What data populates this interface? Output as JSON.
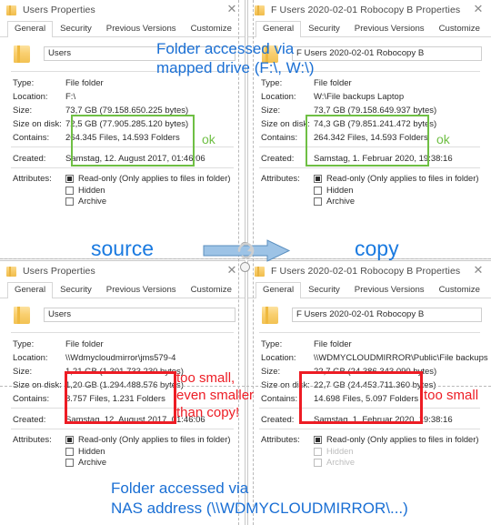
{
  "panels": {
    "top_left": {
      "window_title": "Users Properties",
      "close_label": "✕",
      "tabs": [
        "General",
        "Security",
        "Previous Versions",
        "Customize"
      ],
      "active_tab": "General",
      "name_value": "Users",
      "fields": [
        {
          "label": "Type:",
          "value": "File folder"
        },
        {
          "label": "Location:",
          "value": "F:\\"
        },
        {
          "label": "Size:",
          "value": "73,7 GB (79.158.650.225 bytes)"
        },
        {
          "label": "Size on disk:",
          "value": "72,5 GB (77.905.285.120 bytes)"
        },
        {
          "label": "Contains:",
          "value": "264.345 Files, 14.593 Folders"
        },
        {
          "label": "Created:",
          "value": "Samstag, 12. August 2017, 01:46:06"
        }
      ],
      "attributes_label": "Attributes:",
      "attributes": [
        {
          "text": "Read-only (Only applies to files in folder)",
          "state": "filled"
        },
        {
          "text": "Hidden",
          "state": "empty"
        },
        {
          "text": "Archive",
          "state": "empty"
        }
      ]
    },
    "top_right": {
      "window_title": "F Users 2020-02-01 Robocopy B Properties",
      "close_label": "✕",
      "tabs": [
        "General",
        "Security",
        "Previous Versions",
        "Customize"
      ],
      "active_tab": "General",
      "name_value": "F Users 2020-02-01 Robocopy B",
      "fields": [
        {
          "label": "Type:",
          "value": "File folder"
        },
        {
          "label": "Location:",
          "value": "W:\\File backups Laptop"
        },
        {
          "label": "Size:",
          "value": "73,7 GB (79.158.649.937 bytes)"
        },
        {
          "label": "Size on disk:",
          "value": "74,3 GB (79.851.241.472 bytes)"
        },
        {
          "label": "Contains:",
          "value": "264.342 Files, 14.593 Folders"
        },
        {
          "label": "Created:",
          "value": "Samstag, 1. Februar 2020, 19:38:16"
        }
      ],
      "attributes_label": "Attributes:",
      "attributes": [
        {
          "text": "Read-only (Only applies to files in folder)",
          "state": "filled"
        },
        {
          "text": "Hidden",
          "state": "empty"
        },
        {
          "text": "Archive",
          "state": "empty"
        }
      ]
    },
    "bottom_left": {
      "window_title": "Users Properties",
      "close_label": "✕",
      "tabs": [
        "General",
        "Security",
        "Previous Versions",
        "Customize"
      ],
      "active_tab": "General",
      "name_value": "Users",
      "fields": [
        {
          "label": "Type:",
          "value": "File folder"
        },
        {
          "label": "Location:",
          "value": "\\\\Wdmycloudmirror\\jms579-4"
        },
        {
          "label": "Size:",
          "value": "1,21 GB (1.301.733.230 bytes)"
        },
        {
          "label": "Size on disk:",
          "value": "1,20 GB (1.294.488.576 bytes)"
        },
        {
          "label": "Contains:",
          "value": "8.757 Files, 1.231 Folders"
        },
        {
          "label": "Created:",
          "value": "Samstag, 12. August 2017, 01:46:06"
        }
      ],
      "attributes_label": "Attributes:",
      "attributes": [
        {
          "text": "Read-only (Only applies to files in folder)",
          "state": "filled"
        },
        {
          "text": "Hidden",
          "state": "empty"
        },
        {
          "text": "Archive",
          "state": "empty"
        }
      ]
    },
    "bottom_right": {
      "window_title": "F Users 2020-02-01 Robocopy B Properties",
      "close_label": "✕",
      "tabs": [
        "General",
        "Security",
        "Previous Versions",
        "Customize"
      ],
      "active_tab": "General",
      "name_value": "F Users 2020-02-01 Robocopy B",
      "fields": [
        {
          "label": "Type:",
          "value": "File folder"
        },
        {
          "label": "Location:",
          "value": "\\\\WDMYCLOUDMIRROR\\Public\\File backups Lap"
        },
        {
          "label": "Size:",
          "value": "22,7 GB (24.386.343.090 bytes)"
        },
        {
          "label": "Size on disk:",
          "value": "22,7 GB (24.453.711.360 bytes)"
        },
        {
          "label": "Contains:",
          "value": "14.698 Files, 5.097 Folders"
        },
        {
          "label": "Created:",
          "value": "Samstag, 1. Februar 2020, 19:38:16"
        }
      ],
      "attributes_label": "Attributes:",
      "attributes": [
        {
          "text": "Read-only (Only applies to files in folder)",
          "state": "filled"
        },
        {
          "text": "Hidden",
          "state": "empty"
        },
        {
          "text": "Archive",
          "state": "empty"
        }
      ]
    }
  },
  "annotations": {
    "mapped_drive_line1": "Folder accessed via",
    "mapped_drive_line2": "mapped drive (F:\\, W:\\)",
    "nas_line1": "Folder accessed via",
    "nas_line2": "NAS address (\\\\WDMYCLOUDMIRROR\\...)",
    "ok_top_left": "ok",
    "ok_top_right": "ok",
    "bad_bottom_left_line1": "too small,",
    "bad_bottom_left_line2": "even smaller",
    "bad_bottom_left_line3": "than copy!",
    "bad_bottom_right": "too small",
    "label_source": "source",
    "label_copy": "copy"
  },
  "colors": {
    "ok_green": "#6fbf44",
    "error_red": "#ed1c24",
    "annotation_blue": "#1a6fd4",
    "label_blue": "#1a7ae0",
    "arrow_blue": "#9dc3e6"
  }
}
